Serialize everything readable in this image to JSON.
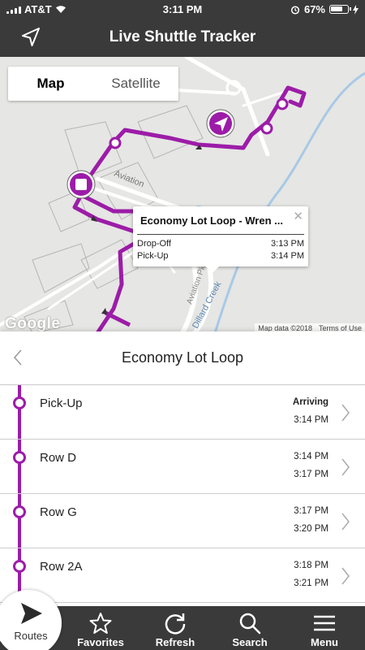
{
  "status_bar": {
    "carrier": "AT&T",
    "time": "3:11 PM",
    "battery": "67%"
  },
  "header": {
    "title": "Live Shuttle Tracker",
    "location_icon": "navigation-arrow-icon"
  },
  "map": {
    "map_type": {
      "options": [
        "Map",
        "Satellite"
      ],
      "selected": "Map"
    },
    "labels": {
      "aviation": "Aviation",
      "pkwy": "Aviation Pkwy",
      "creek": "Dillard Creek"
    },
    "attribution": {
      "logo": "Google",
      "map_data": "Map data ©2018",
      "terms": "Terms of Use"
    },
    "route_color": "#9c1ca8",
    "popup": {
      "title": "Economy Lot Loop - Wren ...",
      "close_icon": "close-icon",
      "rows": [
        {
          "label": "Drop-Off",
          "time": "3:13 PM"
        },
        {
          "label": "Pick-Up",
          "time": "3:14 PM"
        }
      ]
    }
  },
  "route": {
    "title": "Economy Lot Loop",
    "back_icon": "chevron-left-icon"
  },
  "stops": [
    {
      "name": "Pick-Up",
      "time1": "Arriving",
      "time2": "3:14 PM"
    },
    {
      "name": "Row D",
      "time1": "3:14 PM",
      "time2": "3:17 PM"
    },
    {
      "name": "Row G",
      "time1": "3:17 PM",
      "time2": "3:20 PM"
    },
    {
      "name": "Row 2A",
      "time1": "3:18 PM",
      "time2": "3:21 PM"
    }
  ],
  "tabs": [
    {
      "label": "Routes",
      "icon": "routes-arrow-icon"
    },
    {
      "label": "Favorites",
      "icon": "star-icon"
    },
    {
      "label": "Refresh",
      "icon": "refresh-icon"
    },
    {
      "label": "Search",
      "icon": "search-icon"
    },
    {
      "label": "Menu",
      "icon": "menu-icon"
    }
  ]
}
